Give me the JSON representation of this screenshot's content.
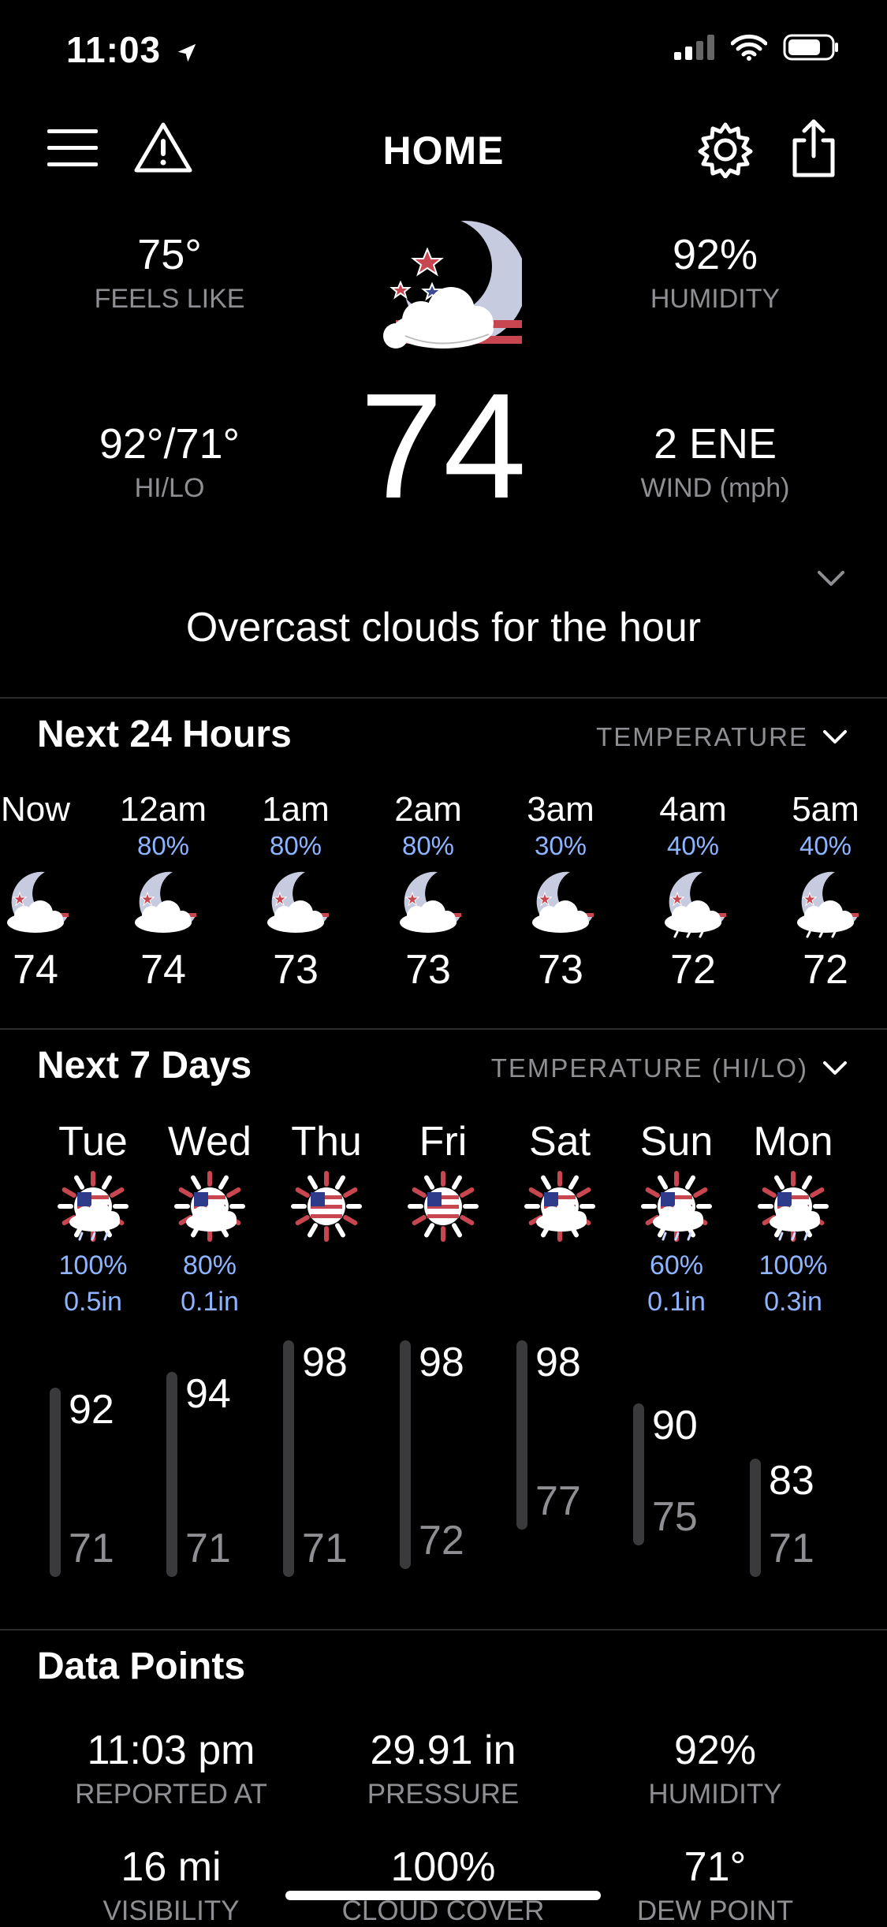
{
  "status_bar": {
    "time": "11:03"
  },
  "header": {
    "title": "HOME"
  },
  "current": {
    "feels_like": {
      "value": "75°",
      "label": "FEELS LIKE"
    },
    "humidity": {
      "value": "92%",
      "label": "HUMIDITY"
    },
    "hilo": {
      "value": "92°/71°",
      "label": "HI/LO"
    },
    "temperature": "74",
    "wind": {
      "value": "2 ENE",
      "label": "WIND (mph)"
    },
    "summary": "Overcast clouds for the hour"
  },
  "hourly": {
    "title": "Next 24 Hours",
    "selector": "TEMPERATURE",
    "items": [
      {
        "time": "Now",
        "pop": "",
        "temp": "74",
        "icon": "night-cloud-icon"
      },
      {
        "time": "12am",
        "pop": "80%",
        "temp": "74",
        "icon": "night-cloud-icon"
      },
      {
        "time": "1am",
        "pop": "80%",
        "temp": "73",
        "icon": "night-cloud-icon"
      },
      {
        "time": "2am",
        "pop": "80%",
        "temp": "73",
        "icon": "night-cloud-icon"
      },
      {
        "time": "3am",
        "pop": "30%",
        "temp": "73",
        "icon": "night-cloud-icon"
      },
      {
        "time": "4am",
        "pop": "40%",
        "temp": "72",
        "icon": "night-rain-icon"
      },
      {
        "time": "5am",
        "pop": "40%",
        "temp": "72",
        "icon": "night-rain-icon"
      }
    ]
  },
  "daily": {
    "title": "Next 7 Days",
    "selector": "TEMPERATURE (HI/LO)",
    "items": [
      {
        "day": "Tue",
        "pop": "100%",
        "precip": "0.5in",
        "hi": 92,
        "lo": 71,
        "hi_label": "92",
        "lo_label": "71",
        "icon": "sun-rain-icon"
      },
      {
        "day": "Wed",
        "pop": "80%",
        "precip": "0.1in",
        "hi": 94,
        "lo": 71,
        "hi_label": "94",
        "lo_label": "71",
        "icon": "sun-cloud-icon"
      },
      {
        "day": "Thu",
        "pop": "",
        "precip": "",
        "hi": 98,
        "lo": 71,
        "hi_label": "98",
        "lo_label": "71",
        "icon": "sun-icon"
      },
      {
        "day": "Fri",
        "pop": "",
        "precip": "",
        "hi": 98,
        "lo": 72,
        "hi_label": "98",
        "lo_label": "72",
        "icon": "sun-icon"
      },
      {
        "day": "Sat",
        "pop": "",
        "precip": "",
        "hi": 98,
        "lo": 77,
        "hi_label": "98",
        "lo_label": "77",
        "icon": "sun-cloud-icon"
      },
      {
        "day": "Sun",
        "pop": "60%",
        "precip": "0.1in",
        "hi": 90,
        "lo": 75,
        "hi_label": "90",
        "lo_label": "75",
        "icon": "sun-rain-icon"
      },
      {
        "day": "Mon",
        "pop": "100%",
        "precip": "0.3in",
        "hi": 83,
        "lo": 71,
        "hi_label": "83",
        "lo_label": "71",
        "icon": "sun-rain-icon"
      }
    ]
  },
  "data_points": {
    "title": "Data Points",
    "items": [
      {
        "value": "11:03 pm",
        "label": "REPORTED AT"
      },
      {
        "value": "29.91 in",
        "label": "PRESSURE"
      },
      {
        "value": "92%",
        "label": "HUMIDITY"
      },
      {
        "value": "16 mi",
        "label": "VISIBILITY"
      },
      {
        "value": "100%",
        "label": "CLOUD COVER"
      },
      {
        "value": "71°",
        "label": "DEW POINT"
      }
    ]
  },
  "colors": {
    "background": "#000000",
    "muted": "#8e8e93",
    "precip": "#8fb4ff",
    "bar": "#3a3a3c"
  }
}
